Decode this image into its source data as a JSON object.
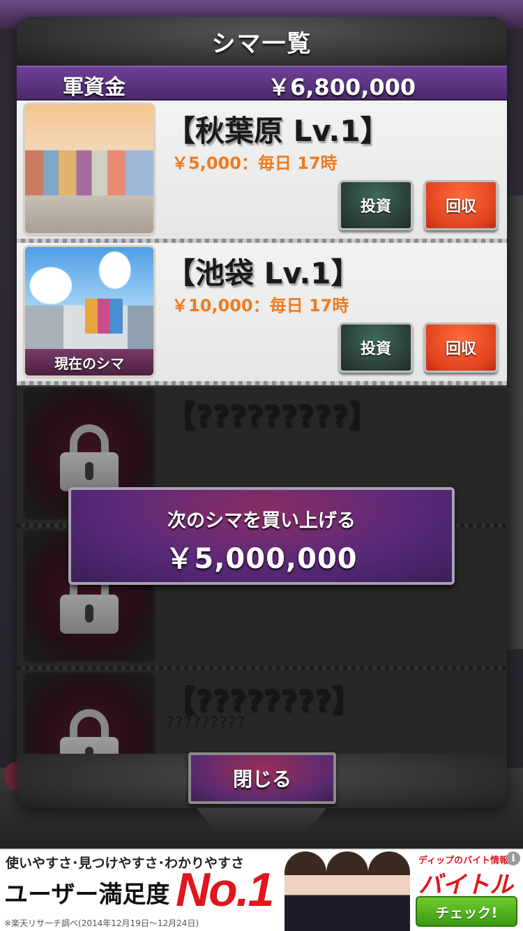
{
  "modal": {
    "title": "シマ一覧",
    "funds_label": "軍資金",
    "funds_value": "￥6,800,000"
  },
  "territories": [
    {
      "name": "【秋葉原 Lv.1】",
      "income": "￥5,000：毎日 17時",
      "invest_label": "投資",
      "collect_label": "回収"
    },
    {
      "name": "【池袋 Lv.1】",
      "income": "￥10,000：毎日 17時",
      "badge": "現在のシマ",
      "invest_label": "投資",
      "collect_label": "回収"
    },
    {
      "name": "【?????????】",
      "desc": ""
    },
    {
      "name": "【????????】",
      "desc": "?????????"
    },
    {
      "name": "【????????】",
      "desc": "?????????"
    }
  ],
  "buy_next": {
    "label": "次のシマを買い上げる",
    "price": "￥5,000,000"
  },
  "close_label": "閉じる",
  "ad": {
    "tagline": "使いやすさ･見つけやすさ･わかりやすさ",
    "headline": "ユーザー満足度",
    "no1": "No.1",
    "footnote": "※楽天リサーチ調べ(2014年12月19日〜12月24日)",
    "brand_small": "ディップのバイト情報",
    "brand": "バイトル",
    "check_label": "チェック!",
    "info_icon": "i"
  },
  "colors": {
    "accent_purple": "#6f3f98",
    "income_orange": "#ee7b1f",
    "collect_red": "#e24420",
    "invest_green": "#2a3e36"
  }
}
